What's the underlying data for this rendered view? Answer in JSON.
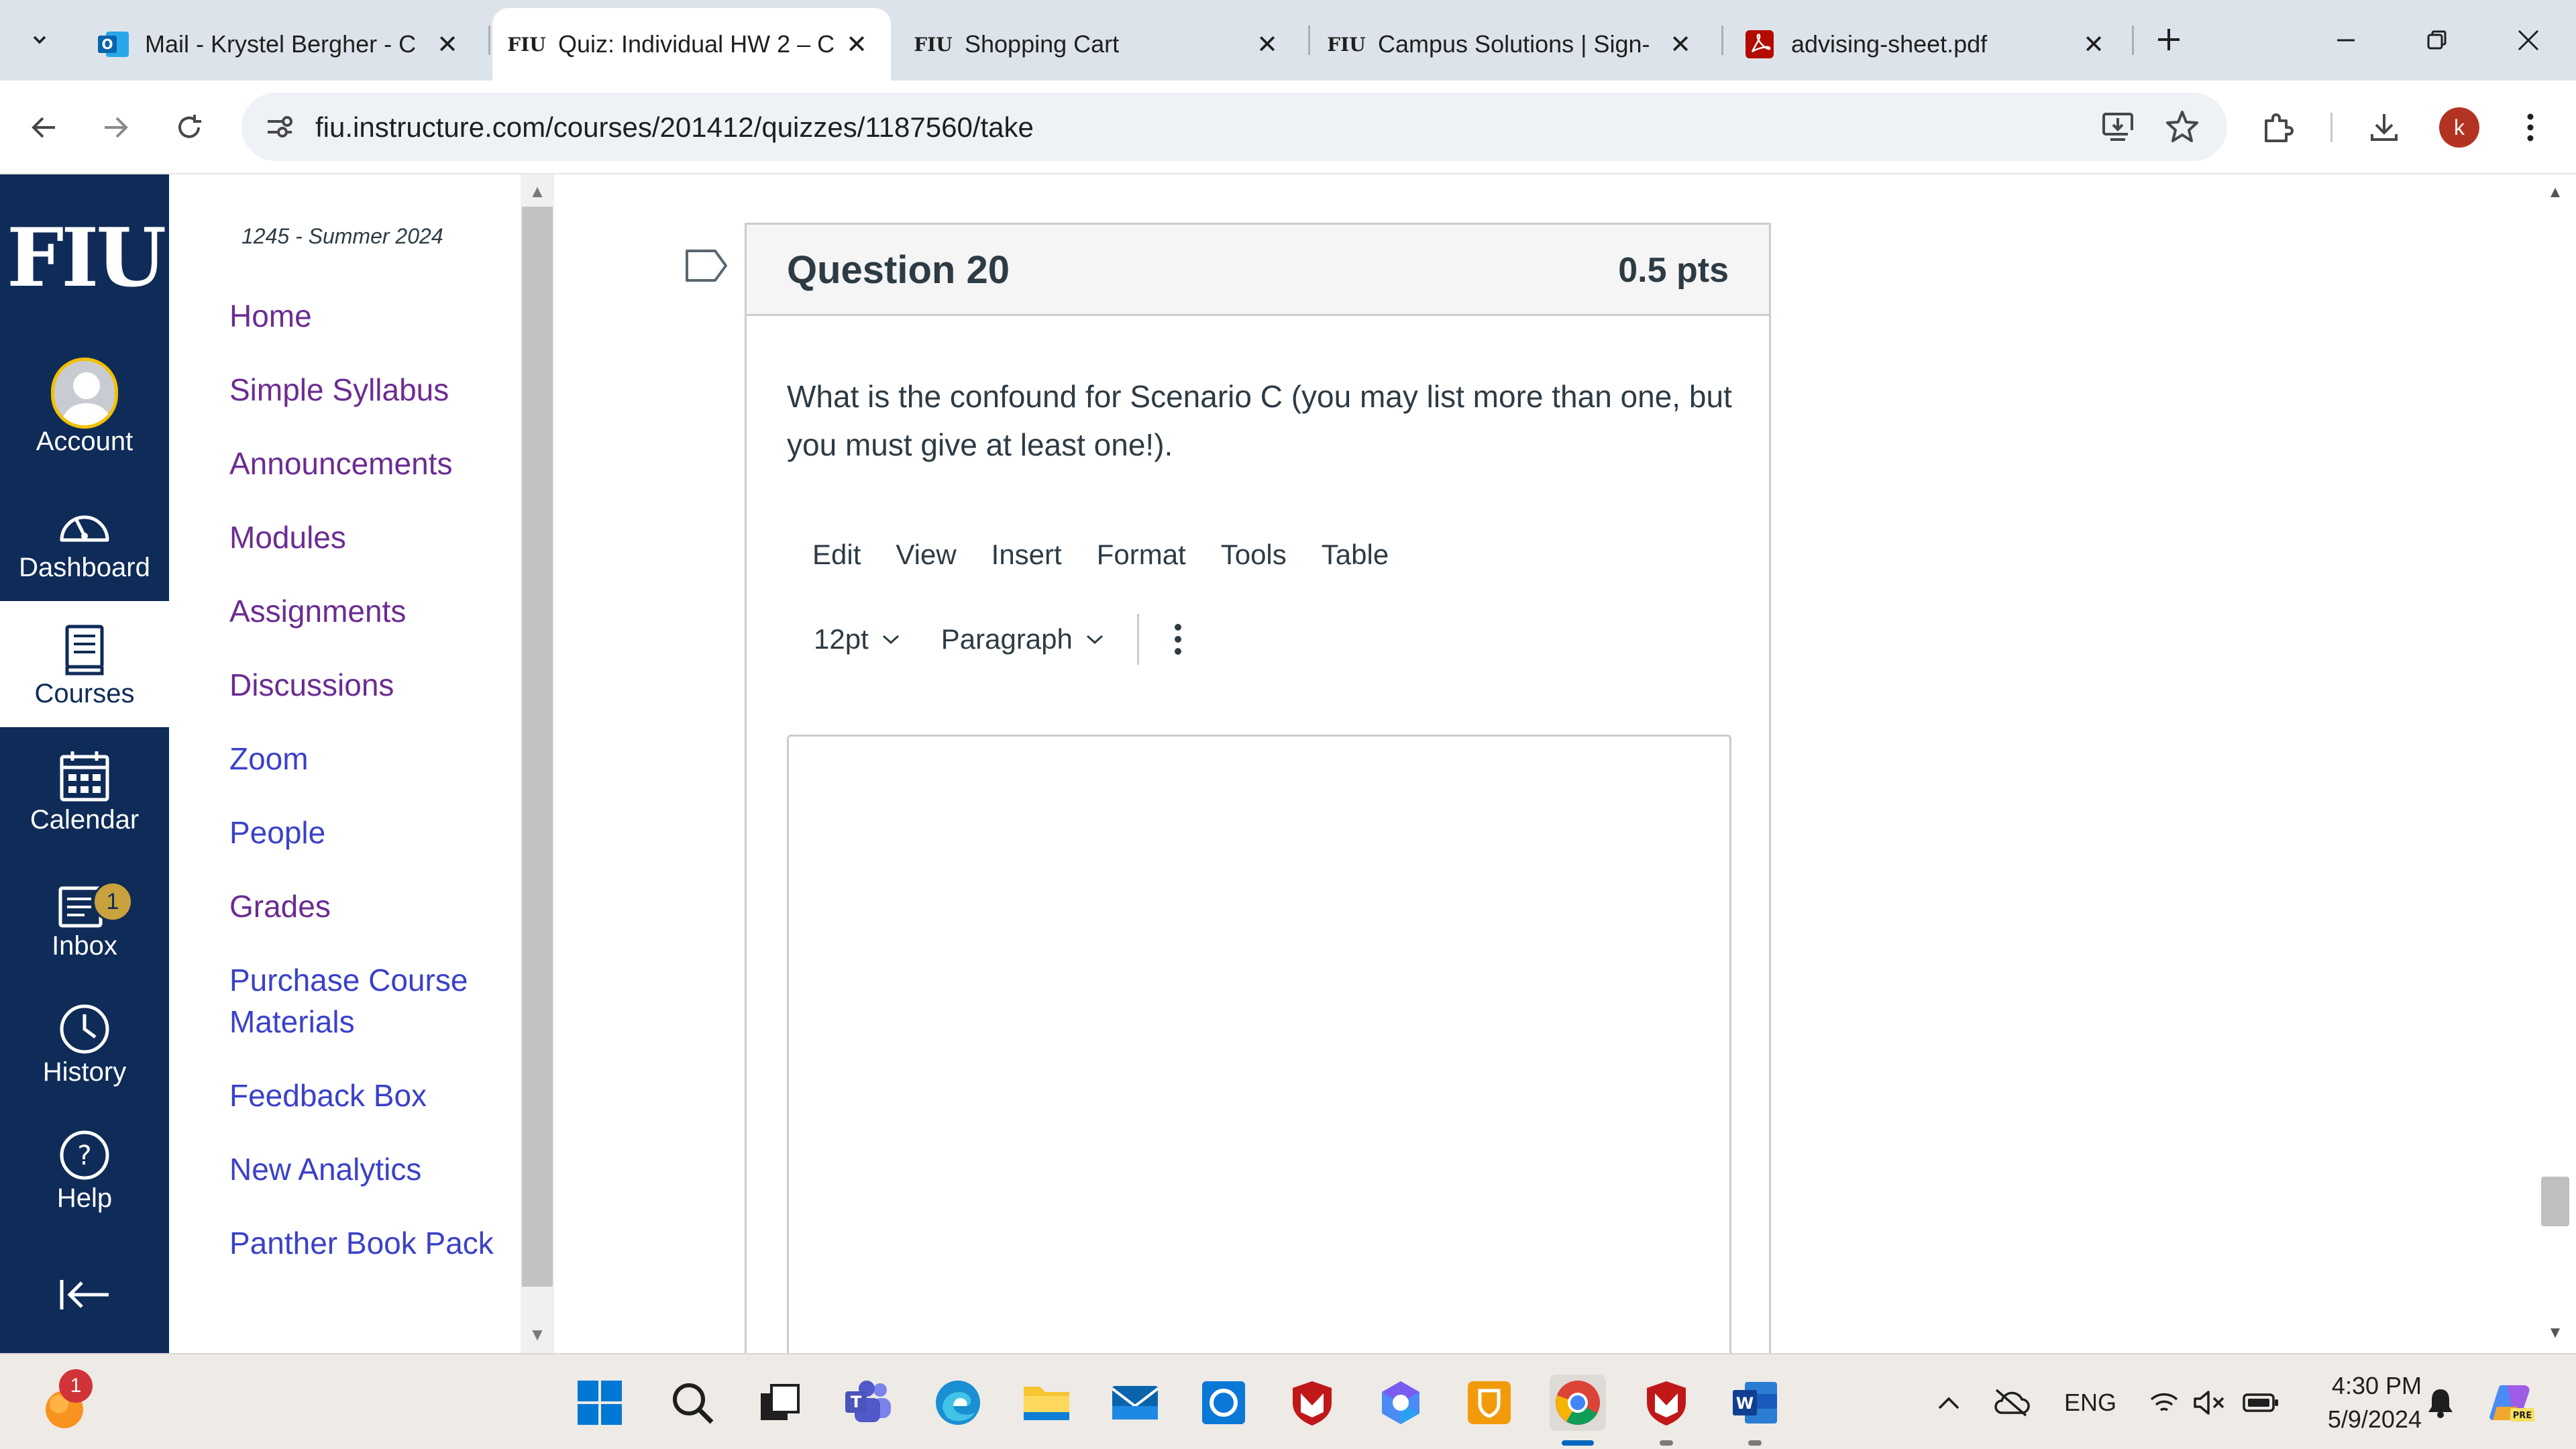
{
  "browser": {
    "tabs": [
      {
        "title": "Mail - Krystel Bergher - C",
        "favicon": "outlook-icon",
        "active": false
      },
      {
        "title": "Quiz: Individual HW 2 – C",
        "favicon_text": "FIU",
        "active": true
      },
      {
        "title": "Shopping Cart",
        "favicon_text": "FIU",
        "active": false
      },
      {
        "title": "Campus Solutions | Sign-",
        "favicon_text": "FIU",
        "active": false
      },
      {
        "title": "advising-sheet.pdf",
        "favicon": "pdf-icon",
        "active": false
      }
    ],
    "url": "fiu.instructure.com/courses/201412/quizzes/1187560/take",
    "profile_initial": "k"
  },
  "global_nav": {
    "logo": "FIU",
    "items": [
      {
        "label": "Account",
        "icon": "account-avatar-icon"
      },
      {
        "label": "Dashboard",
        "icon": "dashboard-icon"
      },
      {
        "label": "Courses",
        "icon": "courses-icon",
        "active": true
      },
      {
        "label": "Calendar",
        "icon": "calendar-icon"
      },
      {
        "label": "Inbox",
        "icon": "inbox-icon",
        "badge": "1"
      },
      {
        "label": "History",
        "icon": "history-icon"
      },
      {
        "label": "Help",
        "icon": "help-icon"
      }
    ]
  },
  "course_nav": {
    "term": "1245 - Summer 2024",
    "items": [
      {
        "label": "Home"
      },
      {
        "label": "Simple Syllabus"
      },
      {
        "label": "Announcements"
      },
      {
        "label": "Modules"
      },
      {
        "label": "Assignments"
      },
      {
        "label": "Discussions"
      },
      {
        "label": "Zoom"
      },
      {
        "label": "People"
      },
      {
        "label": "Grades"
      },
      {
        "label": "Purchase Course Materials"
      },
      {
        "label": "Feedback Box"
      },
      {
        "label": "New Analytics"
      },
      {
        "label": "Panther Book Pack"
      }
    ]
  },
  "question": {
    "title": "Question 20",
    "points": "0.5 pts",
    "text": "What is the confound for Scenario C (you may list more than one, but you must give at least one!).",
    "editor": {
      "menus": [
        "Edit",
        "View",
        "Insert",
        "Format",
        "Tools",
        "Table"
      ],
      "font_size": "12pt",
      "block_format": "Paragraph",
      "content": ""
    }
  },
  "taskbar": {
    "weather_badge": "1",
    "language": "ENG",
    "time": "4:30 PM",
    "date": "5/9/2024"
  },
  "colors": {
    "canvas_nav": "#0f2b58",
    "course_link": "#6b2c91",
    "course_link_visited": "#3a41c9",
    "accent_gold": "#f2c000"
  }
}
